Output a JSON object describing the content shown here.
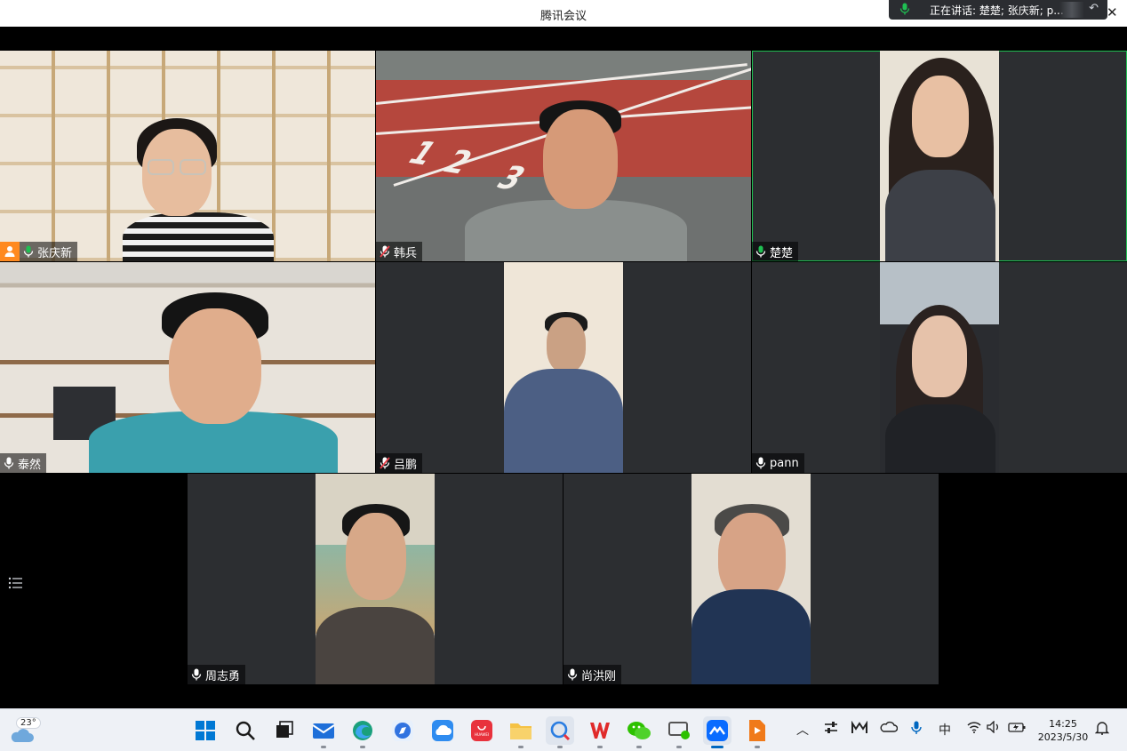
{
  "window": {
    "title": "腾讯会议",
    "speaking_prefix": "正在讲话: ",
    "speaking_names": "楚楚; 张庆新; p..."
  },
  "participants": [
    {
      "name": "张庆新",
      "mic": "on",
      "host": true,
      "active": false
    },
    {
      "name": "韩兵",
      "mic": "muted",
      "host": false,
      "active": false
    },
    {
      "name": "楚楚",
      "mic": "on",
      "host": false,
      "active": true
    },
    {
      "name": "泰然",
      "mic": "on",
      "host": false,
      "active": false
    },
    {
      "name": "吕鹏",
      "mic": "muted",
      "host": false,
      "active": false
    },
    {
      "name": "pann",
      "mic": "on",
      "host": false,
      "active": false
    },
    {
      "name": "周志勇",
      "mic": "on",
      "host": false,
      "active": false
    },
    {
      "name": "尚洪刚",
      "mic": "on",
      "host": false,
      "active": false
    }
  ],
  "taskbar": {
    "weather_temp": "23°",
    "ime": "中",
    "time": "14:25",
    "date": "2023/5/30",
    "app_store_label": "HUAWEI"
  },
  "colors": {
    "active_border": "#1fbf52",
    "host_badge": "#ff8a1f",
    "mic_on": "#ffffff",
    "mic_muted": "#e8404a",
    "tile_bg": "#2c2e31"
  }
}
